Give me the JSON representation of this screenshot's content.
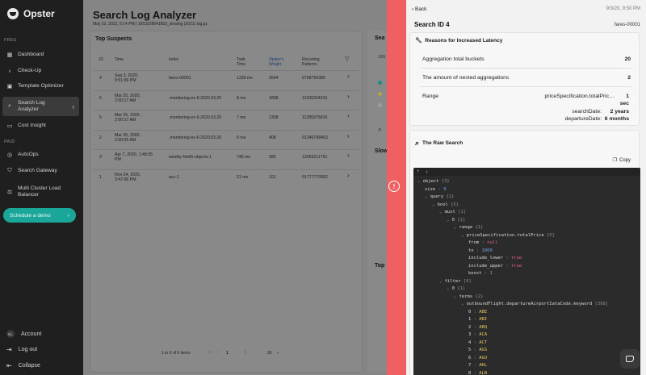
{
  "sidebar": {
    "brand": "Opster",
    "free_label": "FREE",
    "paid_label": "PAID",
    "items": [
      {
        "label": "Dashboard",
        "icon": "grid-icon"
      },
      {
        "label": "Check-Up",
        "icon": "stethoscope-icon"
      },
      {
        "label": "Template Optimizer",
        "icon": "template-icon"
      },
      {
        "label": "Search Log Analyzer",
        "icon": "search-log-icon"
      },
      {
        "label": "Cost Insight",
        "icon": "cost-icon"
      }
    ],
    "paid_items": [
      {
        "label": "AutoOps",
        "icon": "autoops-icon"
      },
      {
        "label": "Search Gateway",
        "icon": "shield-icon"
      },
      {
        "label": "Multi Cluster Load Balancer",
        "icon": "balancer-icon"
      }
    ],
    "demo_button": "Schedule a demo",
    "account": "Account",
    "account_initials": "EL",
    "logout": "Log out",
    "collapse": "Collapse"
  },
  "main": {
    "title": "Search Log Analyzer",
    "subtitle": "May 22, 2022, 5:14 PM | 1653228641853_slowlog (2021).log.gz",
    "panel_title": "Top Suspects",
    "columns": [
      "ID",
      "Time",
      "Index",
      "Took Time",
      "Opster's Weight",
      "Recurring Patterns"
    ],
    "rows": [
      {
        "id": "4",
        "time": "Sep 3, 2020, 9:51:06 PM",
        "index": "fares-00001",
        "took": "1339 ms",
        "weight": "2504",
        "patterns": "0768799380"
      },
      {
        "id": "6",
        "time": "Mar 25, 2020, 2:00:17 AM",
        "index": ".monitoring-es-6-2020.03.20",
        "took": "8 ms",
        "weight": "1808",
        "patterns": "11939324915"
      },
      {
        "id": "5",
        "time": "Mar 25, 2020, 2:00:17 AM",
        "index": ".monitoring-es-6-2020.03.20",
        "took": "7 ms",
        "weight": "1308",
        "patterns": "11285975816"
      },
      {
        "id": "2",
        "time": "Mar 25, 2020, 2:00:05 AM",
        "index": ".monitoring-es-6-2020.03.20",
        "took": "0 ms",
        "weight": "408",
        "patterns": "01346798453"
      },
      {
        "id": "3",
        "time": "Apr 7, 2020, 1:48:55 PM",
        "index": "weekly-html5-objects-1",
        "took": "745 ms",
        "weight": "285",
        "patterns": "12069211751"
      },
      {
        "id": "1",
        "time": "Nov 24, 2020, 3:47:06 PM",
        "index": "acc-1",
        "took": "21 ms",
        "weight": "101",
        "patterns": "01777770952"
      }
    ],
    "pager_text": "1 to 6 of 6 items",
    "current_page": "1",
    "page_size": "20",
    "strip": {
      "t1": "Sea",
      "t2": "Slow",
      "t3": "Top",
      "num": "165"
    }
  },
  "detail": {
    "back": "Back",
    "date": "9/3/20, 9:50 PM",
    "title": "Search ID 4",
    "index": "fares-00001",
    "reasons_title": "Reasons for Increased Latency",
    "reasons": [
      {
        "label": "Aggregation total buckets",
        "value": "20"
      },
      {
        "label": "The amount of nested aggregations",
        "value": "2"
      }
    ],
    "range_label": "Range",
    "range_field": "priceSpecification.totalPric…",
    "range_field_value": "1",
    "range_field_unit": "sec",
    "range_search": "searchDate:",
    "range_search_value": "2 years",
    "range_departure": "departureDate:",
    "range_departure_value": "6 months",
    "raw_title": "The Raw Search",
    "copy": "Copy"
  },
  "code": [
    {
      "indent": 0,
      "text": "object",
      "meta": "{3}",
      "caret": true
    },
    {
      "indent": 1,
      "key": "size",
      "num": "0"
    },
    {
      "indent": 1,
      "text": "query",
      "meta": "{1}",
      "caret": true
    },
    {
      "indent": 2,
      "text": "bool",
      "meta": "{5}",
      "caret": true
    },
    {
      "indent": 3,
      "text": "must",
      "meta": "[1]",
      "caret": true
    },
    {
      "indent": 4,
      "text": "0",
      "meta": "{1}",
      "caret": true
    },
    {
      "indent": 5,
      "text": "range",
      "meta": "{1}",
      "caret": true
    },
    {
      "indent": 6,
      "text": "priceSpecification.totalPrice",
      "meta": "{5}",
      "caret": true
    },
    {
      "indent": 7,
      "key": "from",
      "bool": "null"
    },
    {
      "indent": 7,
      "key": "to",
      "num": "1000"
    },
    {
      "indent": 7,
      "key": "include_lower",
      "bool": "true"
    },
    {
      "indent": 7,
      "key": "include_upper",
      "bool": "true"
    },
    {
      "indent": 7,
      "key": "boost",
      "num": "1"
    },
    {
      "indent": 3,
      "text": "filter",
      "meta": "[8]",
      "caret": true
    },
    {
      "indent": 4,
      "text": "0",
      "meta": "{1}",
      "caret": true
    },
    {
      "indent": 5,
      "text": "terms",
      "meta": "{2}",
      "caret": true
    },
    {
      "indent": 6,
      "text": "outboundFlight.departureAirportIataCode.keyword",
      "meta": "[368]",
      "caret": true
    },
    {
      "indent": 7,
      "key": "0",
      "str": "ABE"
    },
    {
      "indent": 7,
      "key": "1",
      "str": "ABI"
    },
    {
      "indent": 7,
      "key": "2",
      "str": "ABQ"
    },
    {
      "indent": 7,
      "key": "3",
      "str": "ACA"
    },
    {
      "indent": 7,
      "key": "4",
      "str": "ACT"
    },
    {
      "indent": 7,
      "key": "5",
      "str": "AGS"
    },
    {
      "indent": 7,
      "key": "6",
      "str": "AGU"
    },
    {
      "indent": 7,
      "key": "7",
      "str": "AKL"
    },
    {
      "indent": 7,
      "key": "8",
      "str": "ALB"
    }
  ]
}
